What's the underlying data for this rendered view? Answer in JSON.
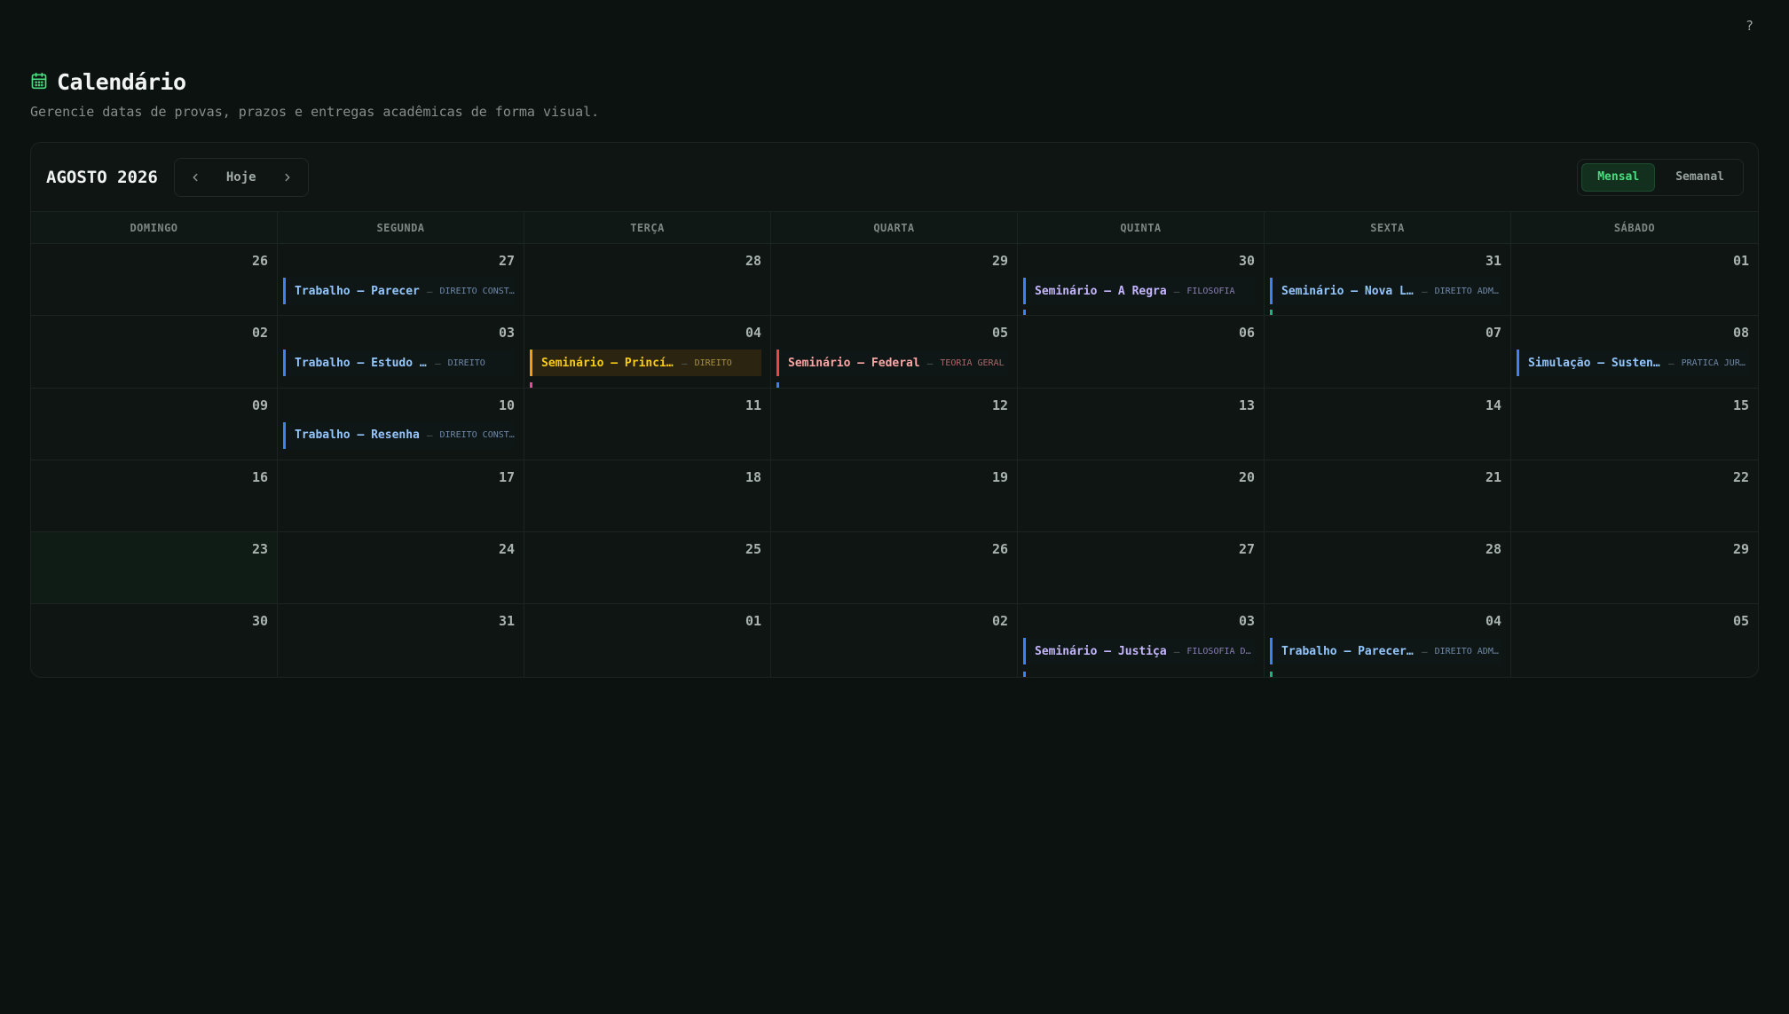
{
  "help_label": "?",
  "header": {
    "title": "Calendário",
    "subtitle": "Gerencie datas de provas, prazos e entregas acadêmicas de forma visual."
  },
  "toolbar": {
    "month_label": "AGOSTO 2026",
    "today_label": "Hoje",
    "views": {
      "monthly": "Mensal",
      "weekly": "Semanal"
    }
  },
  "weekdays": [
    "DOMINGO",
    "SEGUNDA",
    "TERÇA",
    "QUARTA",
    "QUINTA",
    "SEXTA",
    "SÁBADO"
  ],
  "colors": {
    "accent": "#4ade80",
    "event_blue": "#3b82f6",
    "event_yellow": "#f59e0b",
    "event_red": "#ef4444"
  },
  "calendar": {
    "rows": [
      [
        {
          "day": "26"
        },
        {
          "day": "27",
          "event": {
            "title": "Trabalho — Parecer",
            "subject": "DIREITO CONSTITUCIONAL",
            "color": "blue"
          }
        },
        {
          "day": "28"
        },
        {
          "day": "29"
        },
        {
          "day": "30",
          "event": {
            "title": "Seminário — A Regra",
            "subject": "FILOSOFIA",
            "color": "purple"
          },
          "dot": "blue"
        },
        {
          "day": "31",
          "event": {
            "title": "Seminário — Nova Lei",
            "subject": "DIREITO ADMINISTRATIVO",
            "color": "blue"
          },
          "dot": "green"
        },
        {
          "day": "01"
        }
      ],
      [
        {
          "day": "02"
        },
        {
          "day": "03",
          "event": {
            "title": "Trabalho — Estudo de Caso",
            "subject": "DIREITO",
            "color": "blue"
          }
        },
        {
          "day": "04",
          "event": {
            "title": "Seminário — Princípio",
            "subject": "DIREITO",
            "color": "yellow"
          },
          "dot": "pink"
        },
        {
          "day": "05",
          "event": {
            "title": "Seminário — Federal",
            "subject": "TEORIA GERAL",
            "color": "red"
          },
          "dot": "blue"
        },
        {
          "day": "06"
        },
        {
          "day": "07"
        },
        {
          "day": "08",
          "event": {
            "title": "Simulação — Sustentação",
            "subject": "PRÁTICA JURÍDICA",
            "color": "blue"
          }
        }
      ],
      [
        {
          "day": "09"
        },
        {
          "day": "10",
          "event": {
            "title": "Trabalho — Resenha",
            "subject": "DIREITO CONSTITUCIONAL",
            "color": "blue"
          }
        },
        {
          "day": "11"
        },
        {
          "day": "12"
        },
        {
          "day": "13"
        },
        {
          "day": "14"
        },
        {
          "day": "15"
        }
      ],
      [
        {
          "day": "16"
        },
        {
          "day": "17"
        },
        {
          "day": "18"
        },
        {
          "day": "19"
        },
        {
          "day": "20"
        },
        {
          "day": "21"
        },
        {
          "day": "22"
        }
      ],
      [
        {
          "day": "23",
          "today": true
        },
        {
          "day": "24"
        },
        {
          "day": "25"
        },
        {
          "day": "26"
        },
        {
          "day": "27"
        },
        {
          "day": "28"
        },
        {
          "day": "29"
        }
      ],
      [
        {
          "day": "30"
        },
        {
          "day": "31"
        },
        {
          "day": "01"
        },
        {
          "day": "02"
        },
        {
          "day": "03",
          "event": {
            "title": "Seminário — Justiça",
            "subject": "FILOSOFIA DO DIREITO",
            "color": "purple"
          },
          "dot": "blue"
        },
        {
          "day": "04",
          "event": {
            "title": "Trabalho — Parecer sobre",
            "subject": "DIREITO ADMINISTRATIVO",
            "color": "blue"
          },
          "dot": "green"
        },
        {
          "day": "05"
        }
      ]
    ]
  }
}
